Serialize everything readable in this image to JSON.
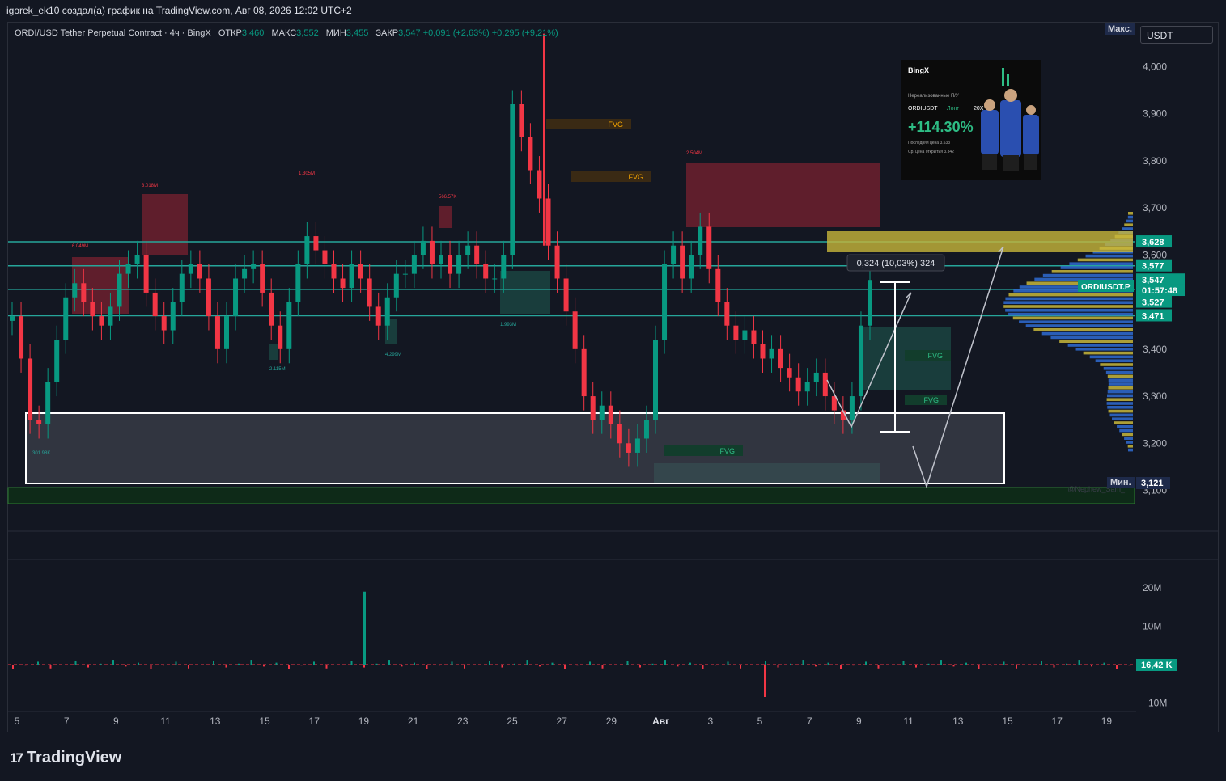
{
  "header": {
    "title": "igorek_ek10 создал(а) график на TradingView.com, Авг 08, 2026 12:02 UTC+2"
  },
  "legend": {
    "symbol": "ORDI/USD Tether Perpetual Contract · 4ч · BingX",
    "open_label": "ОТКР",
    "open": "3,460",
    "high_label": "МАКС",
    "high": "3,552",
    "low_label": "МИН",
    "low": "3,455",
    "close_label": "ЗАКР",
    "close": "3,547",
    "change": "+0,091 (+2,63%)",
    "change2": "+0,295 (+9,21%)"
  },
  "symbol_box": "USDT",
  "max_tag": "Макс.",
  "min_tag": "Мин.",
  "min_value": "3,121",
  "colors": {
    "up": "#089981",
    "down": "#f23645",
    "background": "#131722",
    "hline": "#26a69a",
    "fvg": "#f7a600"
  },
  "price_axis": {
    "ticks": [
      "4,000",
      "3,900",
      "3,800",
      "3,700",
      "3,600",
      "3,500",
      "3,400",
      "3,300",
      "3,200",
      "3,100"
    ]
  },
  "price_labels": [
    {
      "text": "3,628",
      "value": 3.628
    },
    {
      "text": "3,577",
      "value": 3.577
    },
    {
      "text": "3,547",
      "value": 3.547
    },
    {
      "text": "01:57:48",
      "value": 3.525
    },
    {
      "text": "3,527",
      "value": 3.5
    },
    {
      "text": "3,471",
      "value": 3.471
    }
  ],
  "ticker_tag": "ORDIUSDT.P",
  "measure_label": "0,324 (10,03%) 324",
  "fvg_labels": [
    "FVG",
    "FVG",
    "FVG",
    "FVG",
    "FVG"
  ],
  "volume_labels": [
    "3.018M",
    "1.305M",
    "566.57K",
    "2.504M",
    "6.049M",
    "1.993M",
    "4.299M",
    "2.115M",
    "301.98K"
  ],
  "volume_axis": {
    "ticks": [
      "20M",
      "10M",
      "−10M"
    ],
    "current": "16,42 K"
  },
  "time_axis": {
    "ticks": [
      "5",
      "7",
      "9",
      "11",
      "13",
      "15",
      "17",
      "19",
      "21",
      "23",
      "25",
      "27",
      "29",
      "Авг",
      "3",
      "5",
      "7",
      "9",
      "11",
      "13",
      "15",
      "17",
      "19"
    ]
  },
  "watermark": "@Nephew_Sam_",
  "promo": {
    "brand": "BingX",
    "title": "Нереализованные П/У",
    "pair": "ORDIUSDT",
    "side": "Лонг",
    "leverage": "20X",
    "pnl": "+114.30%",
    "last_price_label": "Последняя цена",
    "last_price": "3.533",
    "entry_label": "Ср. цена открытия",
    "entry": "3.342"
  },
  "chart_data": {
    "type": "candlestick",
    "title": "ORDI/USD Tether Perpetual Contract · 4ч · BingX",
    "ylim": [
      3.07,
      4.09
    ],
    "x_ticks": [
      "5",
      "7",
      "9",
      "11",
      "13",
      "15",
      "17",
      "19",
      "21",
      "23",
      "25",
      "27",
      "29",
      "Авг",
      "3",
      "5",
      "7",
      "9",
      "11",
      "13",
      "15",
      "17",
      "19"
    ],
    "closes": [
      3.47,
      3.38,
      3.25,
      3.24,
      3.33,
      3.42,
      3.51,
      3.54,
      3.5,
      3.47,
      3.45,
      3.49,
      3.56,
      3.58,
      3.6,
      3.52,
      3.47,
      3.44,
      3.5,
      3.56,
      3.58,
      3.55,
      3.47,
      3.4,
      3.47,
      3.55,
      3.57,
      3.58,
      3.52,
      3.45,
      3.4,
      3.5,
      3.58,
      3.64,
      3.61,
      3.58,
      3.55,
      3.53,
      3.58,
      3.55,
      3.49,
      3.45,
      3.51,
      3.56,
      3.56,
      3.6,
      3.63,
      3.58,
      3.6,
      3.56,
      3.6,
      3.62,
      3.58,
      3.55,
      3.55,
      3.6,
      3.92,
      3.85,
      3.78,
      3.72,
      3.62,
      3.55,
      3.48,
      3.4,
      3.3,
      3.25,
      3.28,
      3.24,
      3.2,
      3.18,
      3.21,
      3.25,
      3.42,
      3.58,
      3.62,
      3.55,
      3.6,
      3.66,
      3.57,
      3.5,
      3.45,
      3.42,
      3.44,
      3.41,
      3.38,
      3.4,
      3.36,
      3.34,
      3.31,
      3.33,
      3.35,
      3.3,
      3.27,
      3.25,
      3.3,
      3.45,
      3.547
    ],
    "volume_levels": {
      "max": 20,
      "min": -10,
      "unit": "M",
      "spike": 19,
      "current": "16,42 K"
    },
    "horizontal_lines": [
      3.628,
      3.577,
      3.527,
      3.471
    ],
    "range_box": {
      "top": 3.27,
      "bottom": 3.12
    },
    "fvg_zones": [
      "FVG",
      "FVG",
      "FVG",
      "FVG",
      "FVG"
    ]
  }
}
